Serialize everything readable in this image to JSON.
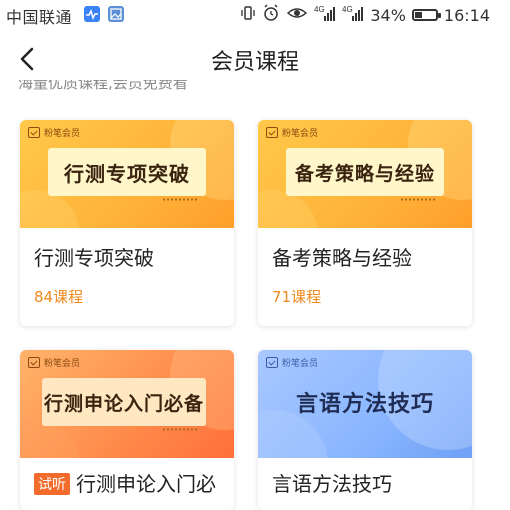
{
  "status_bar": {
    "carrier": "中国联通",
    "battery": "34%",
    "time": "16:14",
    "net_4g_a": "4G",
    "net_4g_b": "4G"
  },
  "header": {
    "title": "会员课程",
    "subtitle_clipped": "海量优质课程,会员免费看"
  },
  "cards": [
    {
      "brand": "粉笔会员",
      "banner": "行测专项突破",
      "title": "行测专项突破",
      "count": "84课程",
      "color": "#ffb23a"
    },
    {
      "brand": "粉笔会员",
      "banner": "备考策略与经验",
      "title": "备考策略与经验",
      "count": "71课程",
      "color": "#ffb23a"
    },
    {
      "brand": "粉笔会员",
      "banner": "行测申论入门必备",
      "tag": "试听",
      "title": "行测申论入门必",
      "color": "#ff8a4a"
    },
    {
      "brand": "粉笔会员",
      "banner": "言语方法技巧",
      "title": "言语方法技巧",
      "color": "#8ab6ff"
    }
  ]
}
